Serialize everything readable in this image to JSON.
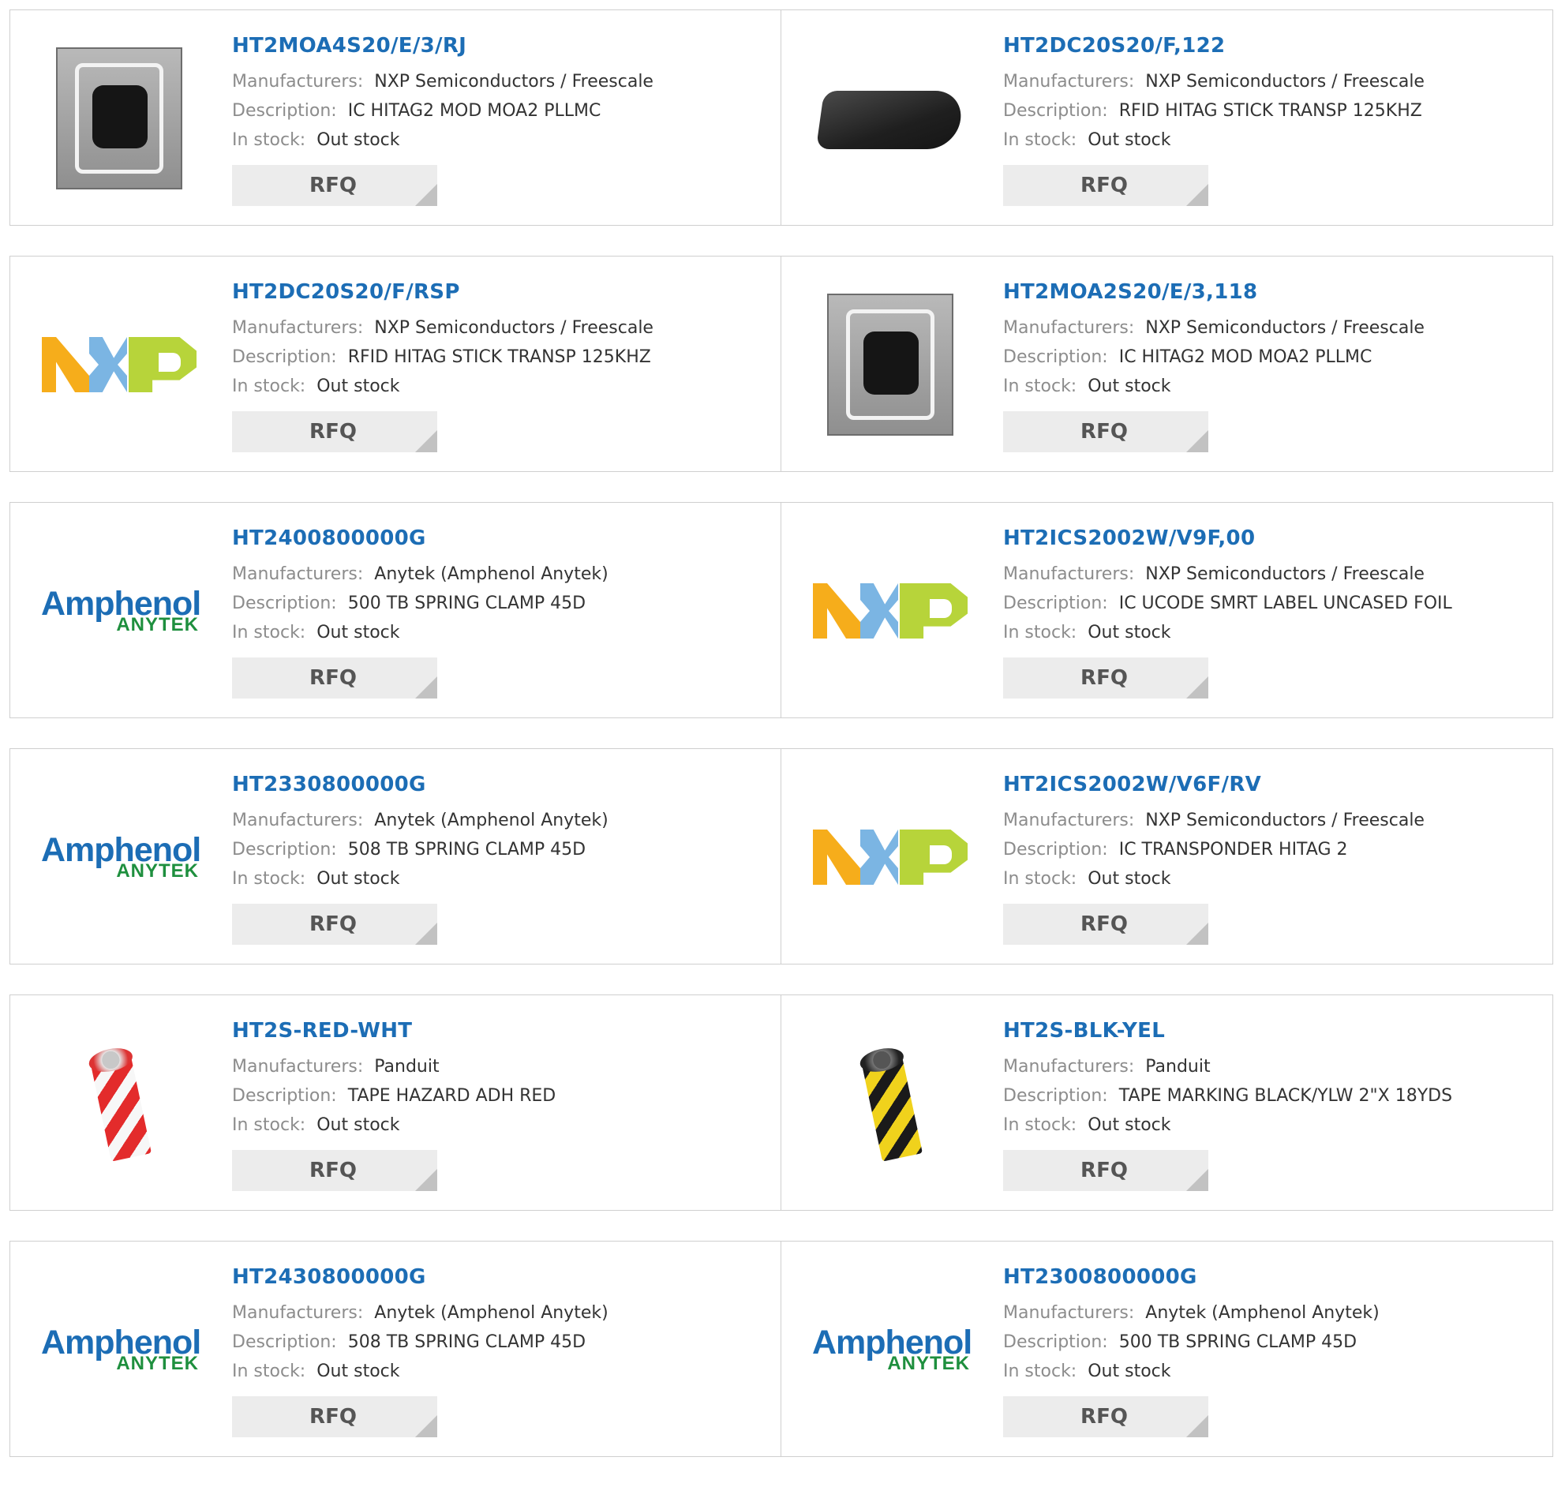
{
  "labels": {
    "manufacturer": "Manufacturers:",
    "description": "Description:",
    "stock": "In stock:",
    "rfq": "RFQ"
  },
  "products": [
    {
      "part": "HT2MOA4S20/E/3/RJ",
      "manufacturer": "NXP Semiconductors / Freescale",
      "description": "IC HITAG2 MOD MOA2 PLLMC",
      "stock": "Out stock",
      "image": "chip-module-image"
    },
    {
      "part": "HT2DC20S20/F,122",
      "manufacturer": "NXP Semiconductors / Freescale",
      "description": "RFID HITAG STICK TRANSP 125KHZ",
      "stock": "Out stock",
      "image": "transponder-stick-image"
    },
    {
      "part": "HT2DC20S20/F/RSP",
      "manufacturer": "NXP Semiconductors / Freescale",
      "description": "RFID HITAG STICK TRANSP 125KHZ",
      "stock": "Out stock",
      "image": "nxp-logo"
    },
    {
      "part": "HT2MOA2S20/E/3,118",
      "manufacturer": "NXP Semiconductors / Freescale",
      "description": "IC HITAG2 MOD MOA2 PLLMC",
      "stock": "Out stock",
      "image": "chip-module-image"
    },
    {
      "part": "HT2400800000G",
      "manufacturer": "Anytek (Amphenol Anytek)",
      "description": "500 TB SPRING CLAMP 45D",
      "stock": "Out stock",
      "image": "amphenol-anytek-logo"
    },
    {
      "part": "HT2ICS2002W/V9F,00",
      "manufacturer": "NXP Semiconductors / Freescale",
      "description": "IC UCODE SMRT LABEL UNCASED FOIL",
      "stock": "Out stock",
      "image": "nxp-logo"
    },
    {
      "part": "HT2330800000G",
      "manufacturer": "Anytek (Amphenol Anytek)",
      "description": "508 TB SPRING CLAMP 45D",
      "stock": "Out stock",
      "image": "amphenol-anytek-logo"
    },
    {
      "part": "HT2ICS2002W/V6F/RV",
      "manufacturer": "NXP Semiconductors / Freescale",
      "description": "IC TRANSPONDER HITAG 2",
      "stock": "Out stock",
      "image": "nxp-logo"
    },
    {
      "part": "HT2S-RED-WHT",
      "manufacturer": "Panduit",
      "description": "TAPE HAZARD ADH RED",
      "stock": "Out stock",
      "image": "red-white-tape-image"
    },
    {
      "part": "HT2S-BLK-YEL",
      "manufacturer": "Panduit",
      "description": "TAPE MARKING BLACK/YLW 2\"X 18YDS",
      "stock": "Out stock",
      "image": "black-yellow-tape-image"
    },
    {
      "part": "HT2430800000G",
      "manufacturer": "Anytek (Amphenol Anytek)",
      "description": "508 TB SPRING CLAMP 45D",
      "stock": "Out stock",
      "image": "amphenol-anytek-logo"
    },
    {
      "part": "HT2300800000G",
      "manufacturer": "Anytek (Amphenol Anytek)",
      "description": "500 TB SPRING CLAMP 45D",
      "stock": "Out stock",
      "image": "amphenol-anytek-logo"
    }
  ],
  "logos": {
    "amphenol": "Amphenol",
    "anytek": "ANYTEK"
  },
  "colors": {
    "part_link": "#1c6db5",
    "label": "#8c8c8c",
    "value": "#333333",
    "rfq_bg": "#ececec",
    "border": "#cfcfcf"
  }
}
